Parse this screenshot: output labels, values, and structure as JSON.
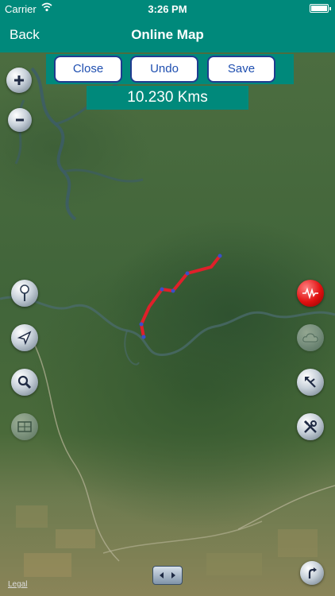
{
  "status_bar": {
    "carrier": "Carrier",
    "time": "3:26 PM"
  },
  "nav": {
    "back_label": "Back",
    "title": "Online Map"
  },
  "toolbar": {
    "close_label": "Close",
    "undo_label": "Undo",
    "save_label": "Save"
  },
  "distance": {
    "text": "10.230 Kms"
  },
  "map": {
    "legal_label": "Legal",
    "route_color": "#e0202a"
  },
  "colors": {
    "accent": "#00897b",
    "button_text": "#1f4fb0",
    "button_border": "#1f3b8f"
  },
  "icons": {
    "zoom_in": "plus-icon",
    "zoom_out": "minus-icon",
    "pin": "pin-icon",
    "locate": "location-arrow-icon",
    "search": "search-icon",
    "map_layers": "map-layers-icon",
    "route": "route-icon",
    "weather": "cloud-icon",
    "directions": "directions-icon",
    "tools": "tools-icon",
    "turn": "turn-arrow-icon",
    "pager": "left-right-arrows-icon"
  }
}
